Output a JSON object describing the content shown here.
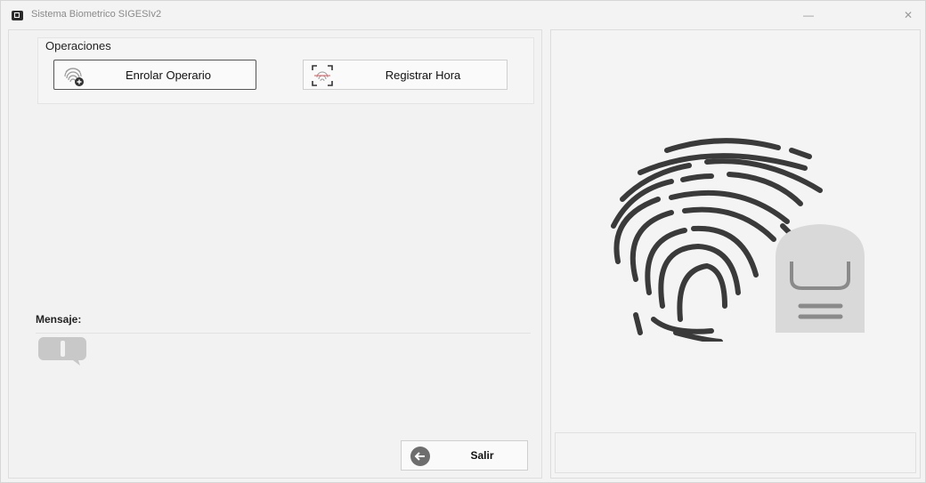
{
  "window": {
    "title": "Sistema Biometrico SIGESIv2",
    "minimize_glyph": "—",
    "close_glyph": "✕"
  },
  "operations": {
    "group_label": "Operaciones",
    "enrolar_label": "Enrolar Operario",
    "enrolar_icon": "fingerprint-add-icon",
    "registrar_label": "Registrar Hora",
    "registrar_icon": "fingerprint-scan-icon"
  },
  "message": {
    "label": "Mensaje:",
    "icon": "info-bubble-icon"
  },
  "exit": {
    "label": "Salir",
    "icon": "exit-arrow-icon"
  },
  "illustration": {
    "icon": "fingerprint-finger-illustration",
    "ridge_color": "#3a3a3a",
    "finger_color": "#d9d9d9"
  }
}
